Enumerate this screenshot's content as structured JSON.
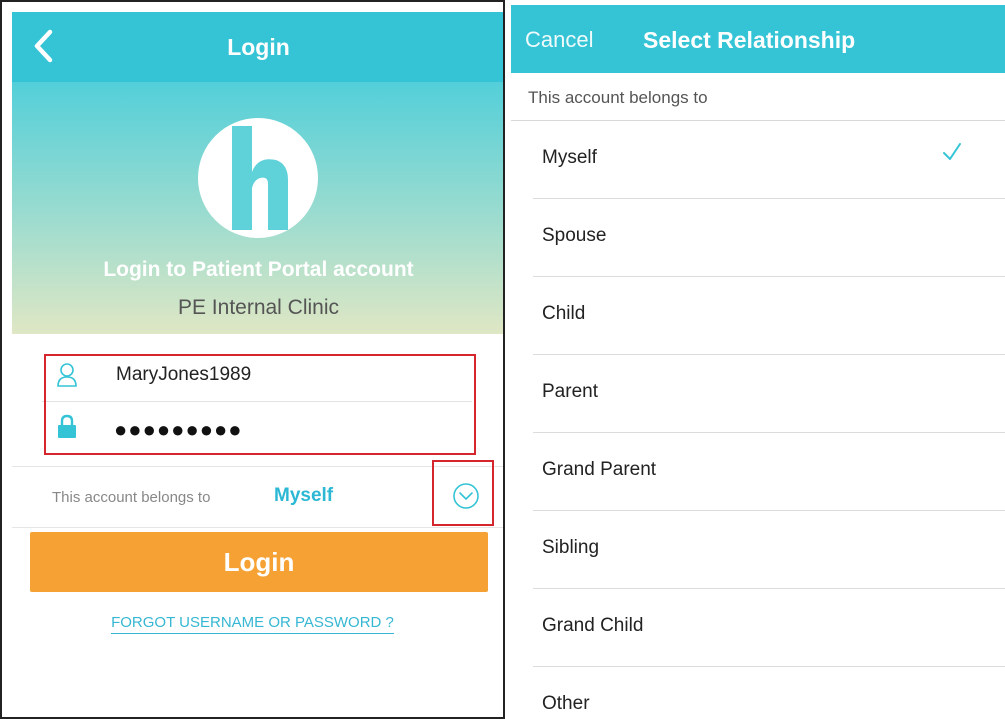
{
  "login_screen": {
    "title": "Login",
    "hero_title": "Login to Patient Portal account",
    "hero_subtitle": "PE Internal Clinic",
    "username": "MaryJones1989",
    "password_masked": "●●●●●●●●●",
    "belongs_label": "This account belongs to",
    "belongs_value": "Myself",
    "login_button": "Login",
    "forgot_link": "FORGOT USERNAME OR PASSWORD ?"
  },
  "relationship_screen": {
    "cancel": "Cancel",
    "title": "Select Relationship",
    "caption": "This account belongs to",
    "options": [
      {
        "label": "Myself",
        "selected": true
      },
      {
        "label": "Spouse",
        "selected": false
      },
      {
        "label": "Child",
        "selected": false
      },
      {
        "label": "Parent",
        "selected": false
      },
      {
        "label": "Grand Parent",
        "selected": false
      },
      {
        "label": "Sibling",
        "selected": false
      },
      {
        "label": "Grand Child",
        "selected": false
      },
      {
        "label": "Other",
        "selected": false
      }
    ]
  },
  "colors": {
    "nav": "#35c4d6",
    "accent": "#2cb8d4",
    "button": "#f6a133",
    "highlight": "#d4262c"
  },
  "icons": {
    "back": "chevron-left-icon",
    "logo": "clinic-logo-icon",
    "username": "user-icon",
    "password": "lock-icon",
    "dropdown": "chevron-down-circle-icon",
    "selected": "checkmark-icon"
  }
}
